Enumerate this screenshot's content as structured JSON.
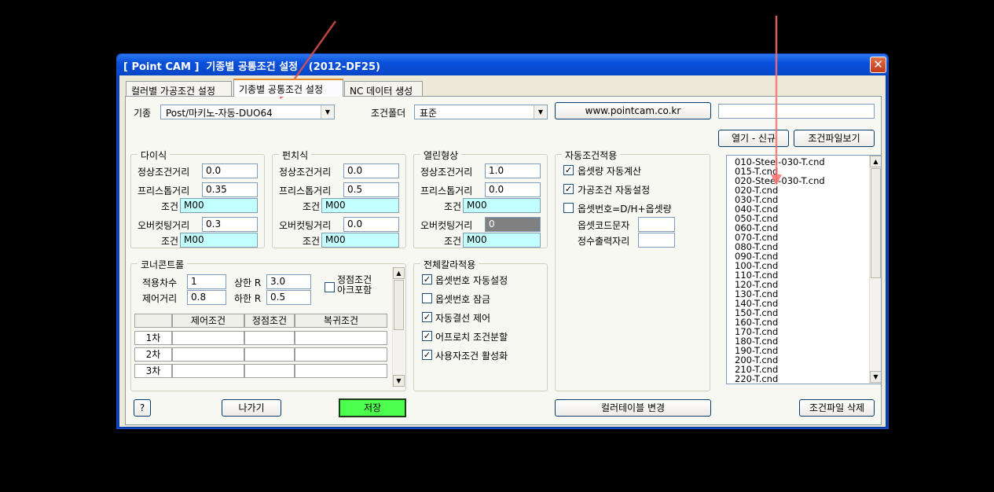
{
  "window": {
    "title": "[ Point CAM ]  기종별 공통조건 설정   (2012-DF25)",
    "close": "✕"
  },
  "tabs": [
    "컬러별 가공조건 설정",
    "기종별 공통조건 설정",
    "NC 데이터 생성"
  ],
  "machine": {
    "label": "기종",
    "value": "Post/마키노-자동-DUO64"
  },
  "folder": {
    "label": "조건폴더",
    "value": "표준"
  },
  "website_button": "www.pointcam.co.kr",
  "path_field": "",
  "open_new_button": "열기 - 신규",
  "view_file_button": "조건파일보기",
  "die_group": {
    "title": "다이식",
    "normal_label": "정상조건거리",
    "normal": "0.0",
    "free_stop_label": "프리스톱거리",
    "free_stop": "0.35",
    "cond1_label": "조건",
    "cond1": "M00",
    "overcut_label": "오버컷팅거리",
    "overcut": "0.3",
    "cond2_label": "조건",
    "cond2": "M00"
  },
  "punch_group": {
    "title": "펀치식",
    "normal_label": "정상조건거리",
    "normal": "0.0",
    "free_stop_label": "프리스톱거리",
    "free_stop": "0.5",
    "cond1_label": "조건",
    "cond1": "M00",
    "overcut_label": "오버컷팅거리",
    "overcut": "0.0",
    "cond2_label": "조건",
    "cond2": "M00"
  },
  "open_group": {
    "title": "열린형상",
    "normal_label": "정상조건거리",
    "normal": "1.0",
    "free_stop_label": "프리스톱거리",
    "free_stop": "0.0",
    "cond1_label": "조건",
    "cond1": "M00",
    "overcut_label": "오버컷팅거리",
    "overcut": "0",
    "cond2_label": "조건",
    "cond2": "M00"
  },
  "auto_group": {
    "title": "자동조건적용",
    "offset_auto": "옵셋량 자동계산",
    "machining_auto": "가공조건 자동설정",
    "offset_number": "옵셋번호=D/H+옵셋량",
    "offset_code_label": "옵셋코드문자",
    "offset_code": "",
    "integer_digits_label": "정수출력자리",
    "integer_digits": ""
  },
  "corner_group": {
    "title": "코너콘트롤",
    "apply_order_label": "적용차수",
    "apply_order": "1",
    "upper_r_label": "상한 R",
    "upper_r": "3.0",
    "control_dist_label": "제어거리",
    "control_dist": "0.8",
    "lower_r_label": "하한 R",
    "lower_r": "0.5",
    "vertex_arc_label": "정점조건\n아크포함",
    "table": {
      "headers": [
        "",
        "제어조건",
        "정점조건",
        "복귀조건"
      ],
      "rows": [
        "1차",
        "2차",
        "3차"
      ]
    }
  },
  "all_color_group": {
    "title": "전체칼라적용",
    "items": [
      {
        "label": "옵셋번호 자동설정",
        "checked": true
      },
      {
        "label": "옵셋번호 잠금",
        "checked": false
      },
      {
        "label": "자동결선 제어",
        "checked": true
      },
      {
        "label": "어프로치 조건분할",
        "checked": true
      },
      {
        "label": "사용자조건 활성화",
        "checked": true
      }
    ]
  },
  "files": [
    "010-Steel-030-T.cnd",
    "015-T.cnd",
    "020-Steel-030-T.cnd",
    "020-T.cnd",
    "030-T.cnd",
    "040-T.cnd",
    "050-T.cnd",
    "060-T.cnd",
    "070-T.cnd",
    "080-T.cnd",
    "090-T.cnd",
    "100-T.cnd",
    "110-T.cnd",
    "120-T.cnd",
    "130-T.cnd",
    "140-T.cnd",
    "150-T.cnd",
    "160-T.cnd",
    "170-T.cnd",
    "180-T.cnd",
    "190-T.cnd",
    "200-T.cnd",
    "210-T.cnd",
    "220-T.cnd"
  ],
  "buttons": {
    "help": "?",
    "exit": "나가기",
    "save": "저장",
    "color_table": "컬러테이블 변경",
    "delete_file": "조건파일 삭제"
  },
  "colors": {
    "annotation_arrow": "#e05050",
    "cyan_field": "#c3ffff",
    "save_button": "#4dff4d"
  }
}
